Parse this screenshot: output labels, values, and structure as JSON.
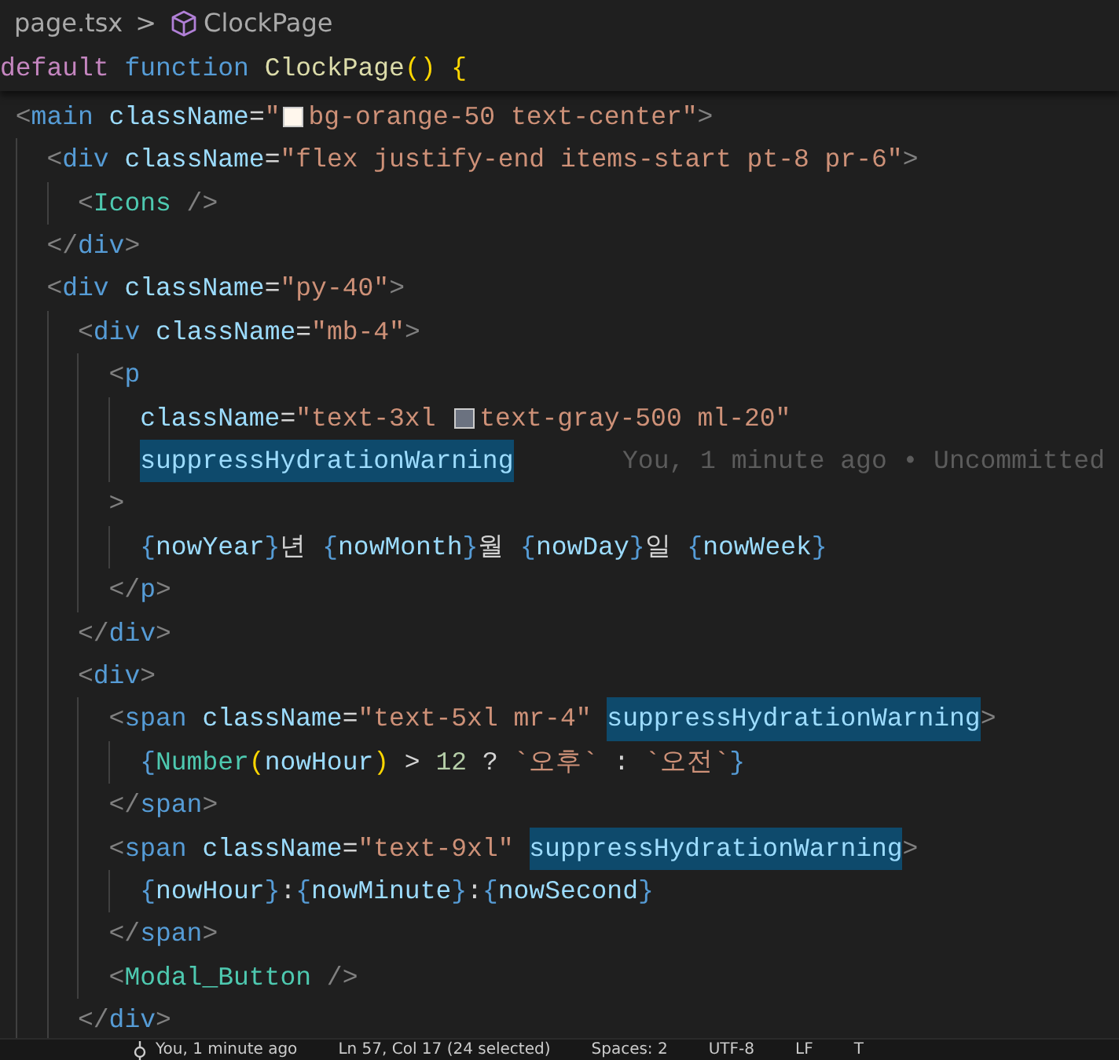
{
  "breadcrumb": {
    "file": "page.tsx",
    "separator": ">",
    "symbol": "ClockPage"
  },
  "sticky_line": {
    "tokens": [
      {
        "kind": "kwc",
        "text": "default"
      },
      {
        "kind": "kw",
        "text": " function"
      },
      {
        "kind": "fn",
        "text": " ClockPage"
      },
      {
        "kind": "br1",
        "text": "()"
      },
      {
        "kind": "br1",
        "text": " {"
      }
    ]
  },
  "lines": [
    {
      "tokens": [
        {
          "kind": "punct",
          "text": "<"
        },
        {
          "kind": "tag",
          "text": "main"
        },
        {
          "kind": "attr",
          "text": " className"
        },
        {
          "kind": "op",
          "text": "="
        },
        {
          "kind": "str",
          "text": "\""
        },
        {
          "kind": "swatch",
          "color": "#fff7ed"
        },
        {
          "kind": "str",
          "text": "bg-orange-50 text-center\""
        },
        {
          "kind": "punct",
          "text": ">"
        }
      ],
      "children": [
        {
          "tokens": [
            {
              "kind": "punct",
              "text": "<"
            },
            {
              "kind": "tag",
              "text": "div"
            },
            {
              "kind": "attr",
              "text": " className"
            },
            {
              "kind": "op",
              "text": "="
            },
            {
              "kind": "str",
              "text": "\"flex justify-end items-start pt-8 pr-6\""
            },
            {
              "kind": "punct",
              "text": ">"
            }
          ],
          "children": [
            {
              "tokens": [
                {
                  "kind": "punct",
                  "text": "<"
                },
                {
                  "kind": "comp",
                  "text": "Icons"
                },
                {
                  "kind": "punct",
                  "text": " />"
                }
              ]
            }
          ]
        },
        {
          "tokens": [
            {
              "kind": "punct",
              "text": "</"
            },
            {
              "kind": "tag",
              "text": "div"
            },
            {
              "kind": "punct",
              "text": ">"
            }
          ]
        },
        {
          "tokens": [
            {
              "kind": "punct",
              "text": "<"
            },
            {
              "kind": "tag",
              "text": "div"
            },
            {
              "kind": "attr",
              "text": " className"
            },
            {
              "kind": "op",
              "text": "="
            },
            {
              "kind": "str",
              "text": "\"py-40\""
            },
            {
              "kind": "punct",
              "text": ">"
            }
          ],
          "children": [
            {
              "tokens": [
                {
                  "kind": "punct",
                  "text": "<"
                },
                {
                  "kind": "tag",
                  "text": "div"
                },
                {
                  "kind": "attr",
                  "text": " className"
                },
                {
                  "kind": "op",
                  "text": "="
                },
                {
                  "kind": "str",
                  "text": "\"mb-4\""
                },
                {
                  "kind": "punct",
                  "text": ">"
                }
              ],
              "children": [
                {
                  "tokens": [
                    {
                      "kind": "punct",
                      "text": "<"
                    },
                    {
                      "kind": "tag",
                      "text": "p"
                    }
                  ],
                  "children": [
                    {
                      "tokens": [
                        {
                          "kind": "attr",
                          "text": "className"
                        },
                        {
                          "kind": "op",
                          "text": "="
                        },
                        {
                          "kind": "str",
                          "text": "\"text-3xl "
                        },
                        {
                          "kind": "swatch",
                          "color": "#6b7280"
                        },
                        {
                          "kind": "str",
                          "text": "text-gray-500 ml-20\""
                        }
                      ]
                    },
                    {
                      "tokens": [
                        {
                          "kind": "match",
                          "text": "suppressHydrationWarning"
                        }
                      ],
                      "blame": "You, 1 minute ago • Uncommitted"
                    }
                  ]
                },
                {
                  "tokens": [
                    {
                      "kind": "punct",
                      "text": ">"
                    }
                  ],
                  "children": [
                    {
                      "tokens": [
                        {
                          "kind": "kw",
                          "text": "{"
                        },
                        {
                          "kind": "var",
                          "text": "nowYear"
                        },
                        {
                          "kind": "kw",
                          "text": "}"
                        },
                        {
                          "kind": "op",
                          "text": "년"
                        },
                        {
                          "kind": "kw",
                          "text": " {"
                        },
                        {
                          "kind": "var",
                          "text": "nowMonth"
                        },
                        {
                          "kind": "kw",
                          "text": "}"
                        },
                        {
                          "kind": "op",
                          "text": "월"
                        },
                        {
                          "kind": "kw",
                          "text": " {"
                        },
                        {
                          "kind": "var",
                          "text": "nowDay"
                        },
                        {
                          "kind": "kw",
                          "text": "}"
                        },
                        {
                          "kind": "op",
                          "text": "일"
                        },
                        {
                          "kind": "kw",
                          "text": " {"
                        },
                        {
                          "kind": "var",
                          "text": "nowWeek"
                        },
                        {
                          "kind": "kw",
                          "text": "}"
                        }
                      ]
                    }
                  ]
                },
                {
                  "tokens": [
                    {
                      "kind": "punct",
                      "text": "</"
                    },
                    {
                      "kind": "tag",
                      "text": "p"
                    },
                    {
                      "kind": "punct",
                      "text": ">"
                    }
                  ]
                }
              ]
            },
            {
              "tokens": [
                {
                  "kind": "punct",
                  "text": "</"
                },
                {
                  "kind": "tag",
                  "text": "div"
                },
                {
                  "kind": "punct",
                  "text": ">"
                }
              ]
            },
            {
              "tokens": [
                {
                  "kind": "punct",
                  "text": "<"
                },
                {
                  "kind": "tag",
                  "text": "div"
                },
                {
                  "kind": "punct",
                  "text": ">"
                }
              ],
              "children": [
                {
                  "tokens": [
                    {
                      "kind": "punct",
                      "text": "<"
                    },
                    {
                      "kind": "tag",
                      "text": "span"
                    },
                    {
                      "kind": "attr",
                      "text": " className"
                    },
                    {
                      "kind": "op",
                      "text": "="
                    },
                    {
                      "kind": "str",
                      "text": "\"text-5xl mr-4\" "
                    },
                    {
                      "kind": "match",
                      "text": "suppressHydrationWarning"
                    },
                    {
                      "kind": "punct",
                      "text": ">"
                    }
                  ],
                  "children": [
                    {
                      "tokens": [
                        {
                          "kind": "kw",
                          "text": "{"
                        },
                        {
                          "kind": "comp",
                          "text": "Number"
                        },
                        {
                          "kind": "br1",
                          "text": "("
                        },
                        {
                          "kind": "var",
                          "text": "nowHour"
                        },
                        {
                          "kind": "br1",
                          "text": ")"
                        },
                        {
                          "kind": "op",
                          "text": " >"
                        },
                        {
                          "kind": "num",
                          "text": " 12"
                        },
                        {
                          "kind": "op",
                          "text": " ?"
                        },
                        {
                          "kind": "str",
                          "text": " `오후`"
                        },
                        {
                          "kind": "op",
                          "text": " :"
                        },
                        {
                          "kind": "str",
                          "text": " `오전`"
                        },
                        {
                          "kind": "kw",
                          "text": "}"
                        }
                      ]
                    }
                  ]
                },
                {
                  "tokens": [
                    {
                      "kind": "punct",
                      "text": "</"
                    },
                    {
                      "kind": "tag",
                      "text": "span"
                    },
                    {
                      "kind": "punct",
                      "text": ">"
                    }
                  ]
                },
                {
                  "tokens": [
                    {
                      "kind": "punct",
                      "text": "<"
                    },
                    {
                      "kind": "tag",
                      "text": "span"
                    },
                    {
                      "kind": "attr",
                      "text": " className"
                    },
                    {
                      "kind": "op",
                      "text": "="
                    },
                    {
                      "kind": "str",
                      "text": "\"text-9xl\" "
                    },
                    {
                      "kind": "match",
                      "text": "suppressHydrationWarning"
                    },
                    {
                      "kind": "punct",
                      "text": ">"
                    }
                  ],
                  "children": [
                    {
                      "tokens": [
                        {
                          "kind": "kw",
                          "text": "{"
                        },
                        {
                          "kind": "var",
                          "text": "nowHour"
                        },
                        {
                          "kind": "kw",
                          "text": "}"
                        },
                        {
                          "kind": "op",
                          "text": ":"
                        },
                        {
                          "kind": "kw",
                          "text": "{"
                        },
                        {
                          "kind": "var",
                          "text": "nowMinute"
                        },
                        {
                          "kind": "kw",
                          "text": "}"
                        },
                        {
                          "kind": "op",
                          "text": ":"
                        },
                        {
                          "kind": "kw",
                          "text": "{"
                        },
                        {
                          "kind": "var",
                          "text": "nowSecond"
                        },
                        {
                          "kind": "kw",
                          "text": "}"
                        }
                      ]
                    }
                  ]
                },
                {
                  "tokens": [
                    {
                      "kind": "punct",
                      "text": "</"
                    },
                    {
                      "kind": "tag",
                      "text": "span"
                    },
                    {
                      "kind": "punct",
                      "text": ">"
                    }
                  ]
                },
                {
                  "tokens": [
                    {
                      "kind": "punct",
                      "text": "<"
                    },
                    {
                      "kind": "comp",
                      "text": "Modal_Button"
                    },
                    {
                      "kind": "punct",
                      "text": " />"
                    }
                  ]
                }
              ]
            },
            {
              "tokens": [
                {
                  "kind": "punct",
                  "text": "</"
                },
                {
                  "kind": "tag",
                  "text": "div"
                },
                {
                  "kind": "punct",
                  "text": ">"
                }
              ]
            }
          ]
        }
      ]
    }
  ],
  "status_bar": [
    {
      "kind": "blame",
      "text": "You, 1 minute ago"
    },
    {
      "kind": "item",
      "text": "Ln 57, Col 17 (24 selected)"
    },
    {
      "kind": "item",
      "text": "Spaces: 2"
    },
    {
      "kind": "item",
      "text": "UTF-8"
    },
    {
      "kind": "item",
      "text": "LF"
    },
    {
      "kind": "item",
      "text": "T"
    }
  ]
}
